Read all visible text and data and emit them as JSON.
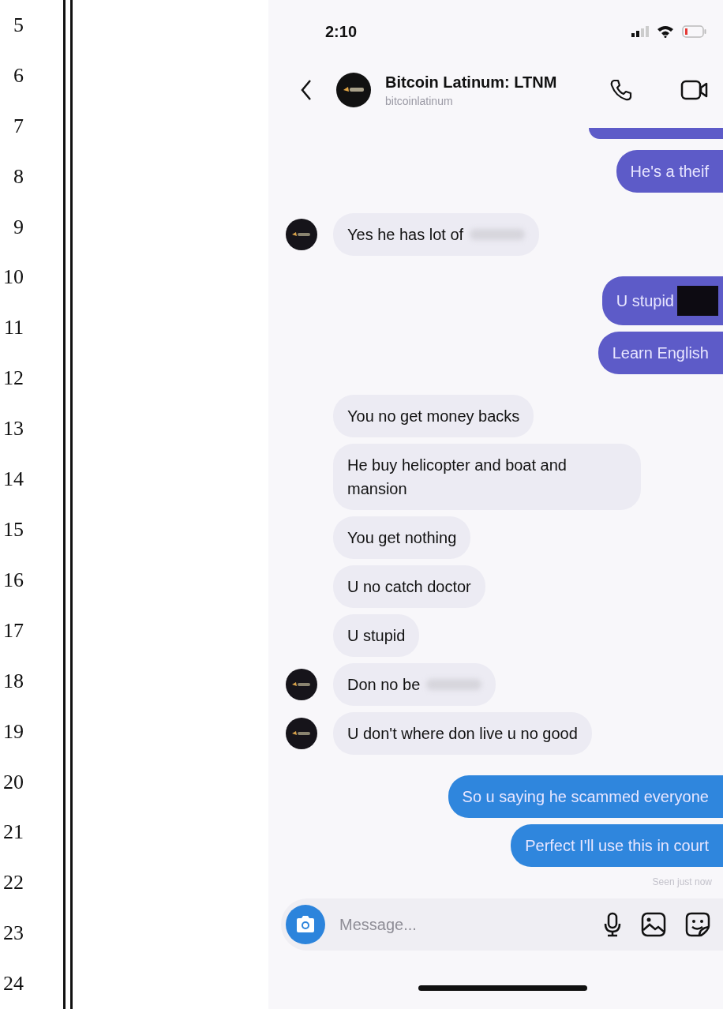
{
  "line_numbers": [
    "5",
    "6",
    "7",
    "8",
    "9",
    "10",
    "11",
    "12",
    "13",
    "14",
    "15",
    "16",
    "17",
    "18",
    "19",
    "20",
    "21",
    "22",
    "23",
    "24"
  ],
  "status_bar": {
    "time": "2:10"
  },
  "header": {
    "title": "Bitcoin Latinum: LTNM",
    "subtitle": "bitcoinlatinum"
  },
  "messages": [
    {
      "kind": "partial",
      "color": "#5d5bc8"
    },
    {
      "kind": "sent",
      "color": "#5d5bc8",
      "text": "He's a theif"
    },
    {
      "kind": "received",
      "color": "#ecebf3",
      "avatar": true,
      "text": "Yes he has lot of",
      "redacted": true
    },
    {
      "kind": "sent",
      "color": "#5d5bc8",
      "text": "U stupid",
      "redacted": true
    },
    {
      "kind": "sent",
      "color": "#5d5bc8",
      "text": "Learn English"
    },
    {
      "kind": "received",
      "color": "#ecebf3",
      "avatar": false,
      "text": "You no get money backs"
    },
    {
      "kind": "received",
      "color": "#ecebf3",
      "avatar": false,
      "text": "He buy helicopter and boat and mansion"
    },
    {
      "kind": "received",
      "color": "#ecebf3",
      "avatar": false,
      "text": "You get nothing"
    },
    {
      "kind": "received",
      "color": "#ecebf3",
      "avatar": false,
      "text": "U no catch doctor"
    },
    {
      "kind": "received",
      "color": "#ecebf3",
      "avatar": false,
      "text": "U stupid"
    },
    {
      "kind": "received",
      "color": "#ecebf3",
      "avatar": true,
      "text": "Don no be",
      "redacted": true
    },
    {
      "kind": "received",
      "color": "#ecebf3",
      "avatar": true,
      "text": "U don't where don live u no good"
    },
    {
      "kind": "sent",
      "color": "#2f86dd",
      "text": "So u saying he scammed everyone"
    },
    {
      "kind": "sent",
      "color": "#2f86dd",
      "text": "Perfect I'll use this in court"
    }
  ],
  "seen": "Seen just now",
  "composer": {
    "placeholder": "Message..."
  }
}
